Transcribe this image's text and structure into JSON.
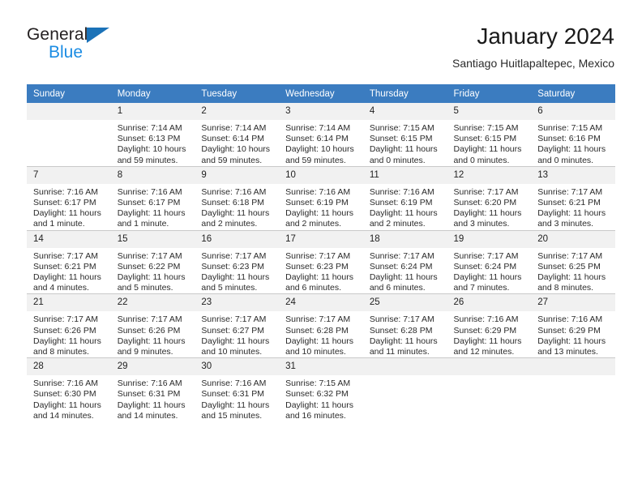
{
  "brand": {
    "name_top": "General",
    "name_bottom": "Blue",
    "triangle_icon": "blue-triangle-logo-mark",
    "accent_color": "#1b72b8",
    "blue_text_color": "#1b8ce3"
  },
  "header": {
    "title": "January 2024",
    "subtitle": "Santiago Huitlapaltepec, Mexico"
  },
  "table": {
    "header_bg": "#3b7cc0",
    "header_text_color": "#ffffff",
    "daynum_bg": "#f1f1f1",
    "weekday_headers": [
      "Sunday",
      "Monday",
      "Tuesday",
      "Wednesday",
      "Thursday",
      "Friday",
      "Saturday"
    ]
  },
  "labels": {
    "sunrise_prefix": "Sunrise:",
    "sunset_prefix": "Sunset:",
    "daylight_prefix": "Daylight:"
  },
  "weeks": [
    [
      {
        "day": "",
        "blank": true,
        "sunrise": "",
        "sunset": "",
        "daylight": ""
      },
      {
        "day": "1",
        "sunrise": "Sunrise: 7:14 AM",
        "sunset": "Sunset: 6:13 PM",
        "daylight": "Daylight: 10 hours and 59 minutes."
      },
      {
        "day": "2",
        "sunrise": "Sunrise: 7:14 AM",
        "sunset": "Sunset: 6:14 PM",
        "daylight": "Daylight: 10 hours and 59 minutes."
      },
      {
        "day": "3",
        "sunrise": "Sunrise: 7:14 AM",
        "sunset": "Sunset: 6:14 PM",
        "daylight": "Daylight: 10 hours and 59 minutes."
      },
      {
        "day": "4",
        "sunrise": "Sunrise: 7:15 AM",
        "sunset": "Sunset: 6:15 PM",
        "daylight": "Daylight: 11 hours and 0 minutes."
      },
      {
        "day": "5",
        "sunrise": "Sunrise: 7:15 AM",
        "sunset": "Sunset: 6:15 PM",
        "daylight": "Daylight: 11 hours and 0 minutes."
      },
      {
        "day": "6",
        "sunrise": "Sunrise: 7:15 AM",
        "sunset": "Sunset: 6:16 PM",
        "daylight": "Daylight: 11 hours and 0 minutes."
      }
    ],
    [
      {
        "day": "7",
        "sunrise": "Sunrise: 7:16 AM",
        "sunset": "Sunset: 6:17 PM",
        "daylight": "Daylight: 11 hours and 1 minute."
      },
      {
        "day": "8",
        "sunrise": "Sunrise: 7:16 AM",
        "sunset": "Sunset: 6:17 PM",
        "daylight": "Daylight: 11 hours and 1 minute."
      },
      {
        "day": "9",
        "sunrise": "Sunrise: 7:16 AM",
        "sunset": "Sunset: 6:18 PM",
        "daylight": "Daylight: 11 hours and 2 minutes."
      },
      {
        "day": "10",
        "sunrise": "Sunrise: 7:16 AM",
        "sunset": "Sunset: 6:19 PM",
        "daylight": "Daylight: 11 hours and 2 minutes."
      },
      {
        "day": "11",
        "sunrise": "Sunrise: 7:16 AM",
        "sunset": "Sunset: 6:19 PM",
        "daylight": "Daylight: 11 hours and 2 minutes."
      },
      {
        "day": "12",
        "sunrise": "Sunrise: 7:17 AM",
        "sunset": "Sunset: 6:20 PM",
        "daylight": "Daylight: 11 hours and 3 minutes."
      },
      {
        "day": "13",
        "sunrise": "Sunrise: 7:17 AM",
        "sunset": "Sunset: 6:21 PM",
        "daylight": "Daylight: 11 hours and 3 minutes."
      }
    ],
    [
      {
        "day": "14",
        "sunrise": "Sunrise: 7:17 AM",
        "sunset": "Sunset: 6:21 PM",
        "daylight": "Daylight: 11 hours and 4 minutes."
      },
      {
        "day": "15",
        "sunrise": "Sunrise: 7:17 AM",
        "sunset": "Sunset: 6:22 PM",
        "daylight": "Daylight: 11 hours and 5 minutes."
      },
      {
        "day": "16",
        "sunrise": "Sunrise: 7:17 AM",
        "sunset": "Sunset: 6:23 PM",
        "daylight": "Daylight: 11 hours and 5 minutes."
      },
      {
        "day": "17",
        "sunrise": "Sunrise: 7:17 AM",
        "sunset": "Sunset: 6:23 PM",
        "daylight": "Daylight: 11 hours and 6 minutes."
      },
      {
        "day": "18",
        "sunrise": "Sunrise: 7:17 AM",
        "sunset": "Sunset: 6:24 PM",
        "daylight": "Daylight: 11 hours and 6 minutes."
      },
      {
        "day": "19",
        "sunrise": "Sunrise: 7:17 AM",
        "sunset": "Sunset: 6:24 PM",
        "daylight": "Daylight: 11 hours and 7 minutes."
      },
      {
        "day": "20",
        "sunrise": "Sunrise: 7:17 AM",
        "sunset": "Sunset: 6:25 PM",
        "daylight": "Daylight: 11 hours and 8 minutes."
      }
    ],
    [
      {
        "day": "21",
        "sunrise": "Sunrise: 7:17 AM",
        "sunset": "Sunset: 6:26 PM",
        "daylight": "Daylight: 11 hours and 8 minutes."
      },
      {
        "day": "22",
        "sunrise": "Sunrise: 7:17 AM",
        "sunset": "Sunset: 6:26 PM",
        "daylight": "Daylight: 11 hours and 9 minutes."
      },
      {
        "day": "23",
        "sunrise": "Sunrise: 7:17 AM",
        "sunset": "Sunset: 6:27 PM",
        "daylight": "Daylight: 11 hours and 10 minutes."
      },
      {
        "day": "24",
        "sunrise": "Sunrise: 7:17 AM",
        "sunset": "Sunset: 6:28 PM",
        "daylight": "Daylight: 11 hours and 10 minutes."
      },
      {
        "day": "25",
        "sunrise": "Sunrise: 7:17 AM",
        "sunset": "Sunset: 6:28 PM",
        "daylight": "Daylight: 11 hours and 11 minutes."
      },
      {
        "day": "26",
        "sunrise": "Sunrise: 7:16 AM",
        "sunset": "Sunset: 6:29 PM",
        "daylight": "Daylight: 11 hours and 12 minutes."
      },
      {
        "day": "27",
        "sunrise": "Sunrise: 7:16 AM",
        "sunset": "Sunset: 6:29 PM",
        "daylight": "Daylight: 11 hours and 13 minutes."
      }
    ],
    [
      {
        "day": "28",
        "sunrise": "Sunrise: 7:16 AM",
        "sunset": "Sunset: 6:30 PM",
        "daylight": "Daylight: 11 hours and 14 minutes."
      },
      {
        "day": "29",
        "sunrise": "Sunrise: 7:16 AM",
        "sunset": "Sunset: 6:31 PM",
        "daylight": "Daylight: 11 hours and 14 minutes."
      },
      {
        "day": "30",
        "sunrise": "Sunrise: 7:16 AM",
        "sunset": "Sunset: 6:31 PM",
        "daylight": "Daylight: 11 hours and 15 minutes."
      },
      {
        "day": "31",
        "sunrise": "Sunrise: 7:15 AM",
        "sunset": "Sunset: 6:32 PM",
        "daylight": "Daylight: 11 hours and 16 minutes."
      },
      {
        "day": "",
        "blank": true,
        "sunrise": "",
        "sunset": "",
        "daylight": ""
      },
      {
        "day": "",
        "blank": true,
        "sunrise": "",
        "sunset": "",
        "daylight": ""
      },
      {
        "day": "",
        "blank": true,
        "sunrise": "",
        "sunset": "",
        "daylight": ""
      }
    ]
  ]
}
